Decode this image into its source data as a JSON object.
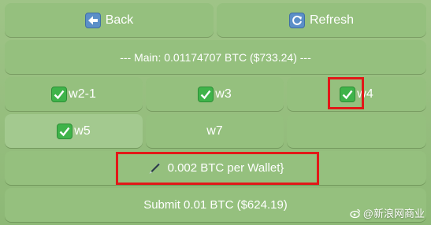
{
  "buttons": {
    "back": "Back",
    "refresh": "Refresh",
    "main_balance": "--- Main: 0.01174707 BTC ($733.24) ---",
    "w2_1": "w2-1",
    "w3": "w3",
    "w4": "w4",
    "w5": "w5",
    "w7": "w7",
    "empty": "",
    "per_wallet": "0.002 BTC per Wallet}",
    "submit": "Submit 0.01 BTC ($624.19)"
  },
  "icons": {
    "back": "back-arrow-icon",
    "refresh": "refresh-icon",
    "check": "check-mark-icon",
    "pen": "pen-icon"
  },
  "watermark": "@新浪网商业",
  "colors": {
    "highlight": "#e21818",
    "button": "#95c07e",
    "check": "#3fb34a"
  }
}
